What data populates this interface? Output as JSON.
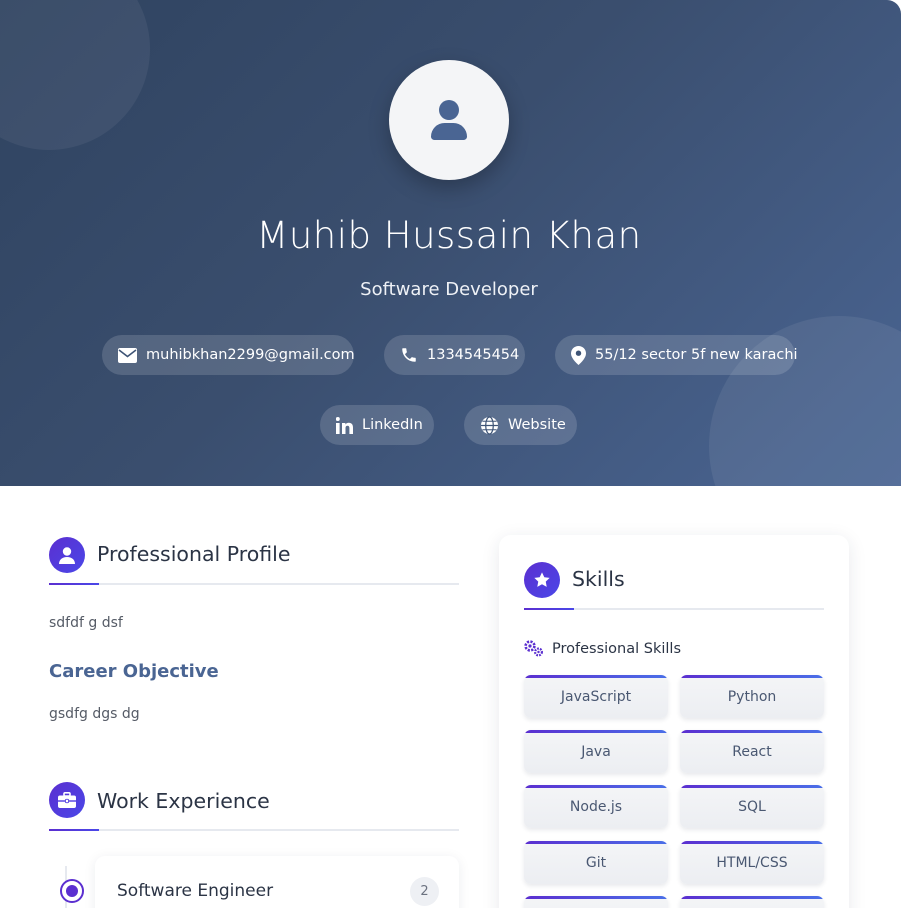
{
  "header": {
    "name": "Muhib Hussain Khan",
    "title": "Software Developer",
    "contacts": {
      "email": "muhibkhan2299@gmail.com",
      "phone": "1334545454",
      "location": "55/12 sector 5f new karachi"
    },
    "links": {
      "linkedin": "LinkedIn",
      "website": "Website"
    }
  },
  "profile": {
    "heading": "Professional Profile",
    "summary": "sdfdf g dsf",
    "career_heading": "Career Objective",
    "career_text": "gsdfg dgs dg"
  },
  "experience": {
    "heading": "Work Experience",
    "items": [
      {
        "title": "Software Engineer",
        "badge": "2"
      }
    ]
  },
  "skills": {
    "heading": "Skills",
    "subheading": "Professional Skills",
    "items": [
      "JavaScript",
      "Python",
      "Java",
      "React",
      "Node.js",
      "SQL",
      "Git",
      "HTML/CSS",
      "",
      ""
    ]
  },
  "colors": {
    "header_gradient_start": "#2f4360",
    "header_gradient_end": "#4a6593",
    "accent_purple": "#5b2fd0",
    "accent_blue": "#4a47e8",
    "career_heading": "#4a6593"
  },
  "icons": {
    "avatar": "user-icon",
    "email": "envelope-icon",
    "phone": "phone-icon",
    "location": "map-pin-icon",
    "linkedin": "linkedin-icon",
    "website": "globe-icon",
    "profile": "user-icon",
    "experience": "briefcase-icon",
    "skills": "star-icon",
    "professional_skills": "gears-icon"
  }
}
